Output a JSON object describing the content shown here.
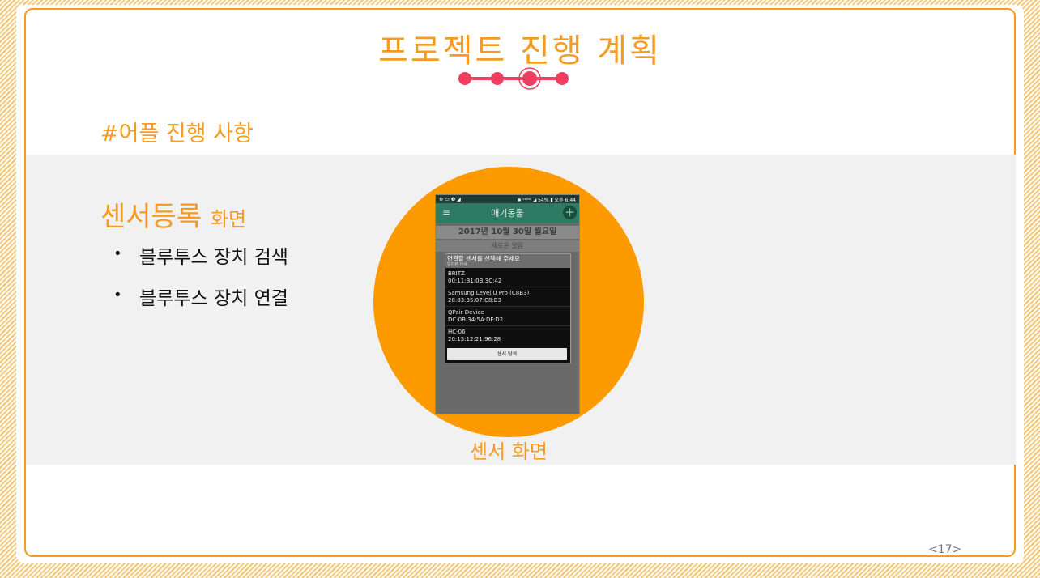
{
  "slide": {
    "title": "프로젝트 진행 계획",
    "progress_steps": 4,
    "progress_active_index": 2,
    "section_heading": "#어플 진행 사항",
    "subtitle_main": "센서등록",
    "subtitle_small": "화면",
    "bullets": [
      "블루투스 장치 검색",
      "블루투스 장치 연결"
    ],
    "caption": "센서 화면",
    "page_number": "<17>",
    "colors": {
      "accent": "#f59b22",
      "circle": "#fd9a00",
      "progress": "#f03e5e"
    }
  },
  "phone": {
    "status_left": "⚙ ▭ ❶ ◢",
    "status_right": "✱ ᵛᵒˡᵗᵉ ◢ 54% ▮ 오후 6:44",
    "app_title": "애기동물",
    "menu_icon": "≡",
    "plus_icon": "+",
    "date": "2017년 10월 30일 월요일",
    "new_alarm": "새로운 알림",
    "dialog_title": "연결할 센서를 선택해 주세요",
    "dialog_subtitle": "알지된 센서",
    "devices": [
      {
        "name": "BRITZ",
        "address": "00:11:B1:0B:3C:42"
      },
      {
        "name": "Samsung Level U Pro (C8B3)",
        "address": "28:83:35:07:C8:B3"
      },
      {
        "name": "QPair Device",
        "address": "DC:0B:34:5A:DF:D2"
      },
      {
        "name": "HC-06",
        "address": "20:15:12:21:96:28"
      }
    ],
    "scan_button": "센서 탐색"
  }
}
